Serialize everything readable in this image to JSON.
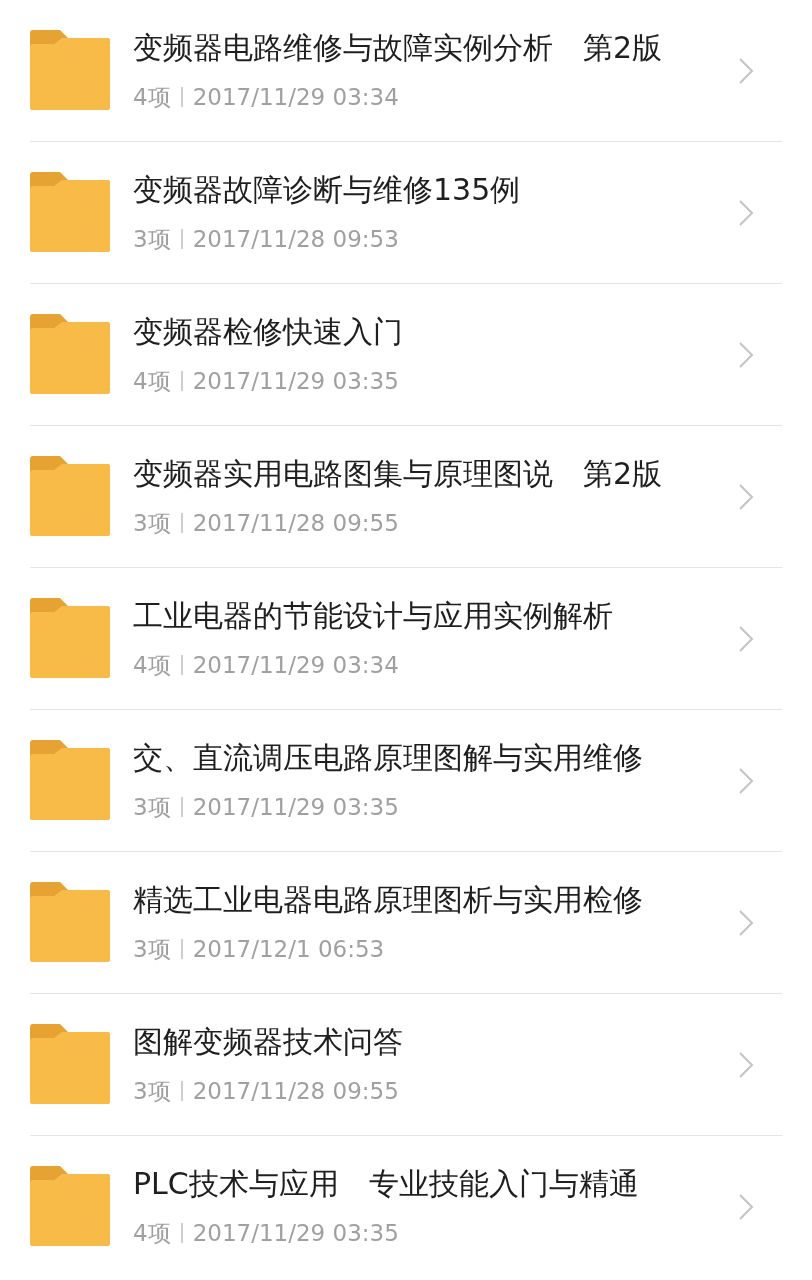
{
  "folders": [
    {
      "name": "变频器电路维修与故障实例分析　第2版",
      "count": "4项",
      "date": "2017/11/29 03:34"
    },
    {
      "name": "变频器故障诊断与维修135例",
      "count": "3项",
      "date": "2017/11/28 09:53"
    },
    {
      "name": "变频器检修快速入门",
      "count": "4项",
      "date": "2017/11/29 03:35"
    },
    {
      "name": "变频器实用电路图集与原理图说　第2版",
      "count": "3项",
      "date": "2017/11/28 09:55"
    },
    {
      "name": "工业电器的节能设计与应用实例解析",
      "count": "4项",
      "date": "2017/11/29 03:34"
    },
    {
      "name": "交、直流调压电路原理图解与实用维修",
      "count": "3项",
      "date": "2017/11/29 03:35"
    },
    {
      "name": "精选工业电器电路原理图析与实用检修",
      "count": "3项",
      "date": "2017/12/1 06:53"
    },
    {
      "name": "图解变频器技术问答",
      "count": "3项",
      "date": "2017/11/28 09:55"
    },
    {
      "name": "PLC技术与应用　专业技能入门与精通",
      "count": "4项",
      "date": "2017/11/29 03:35"
    }
  ]
}
